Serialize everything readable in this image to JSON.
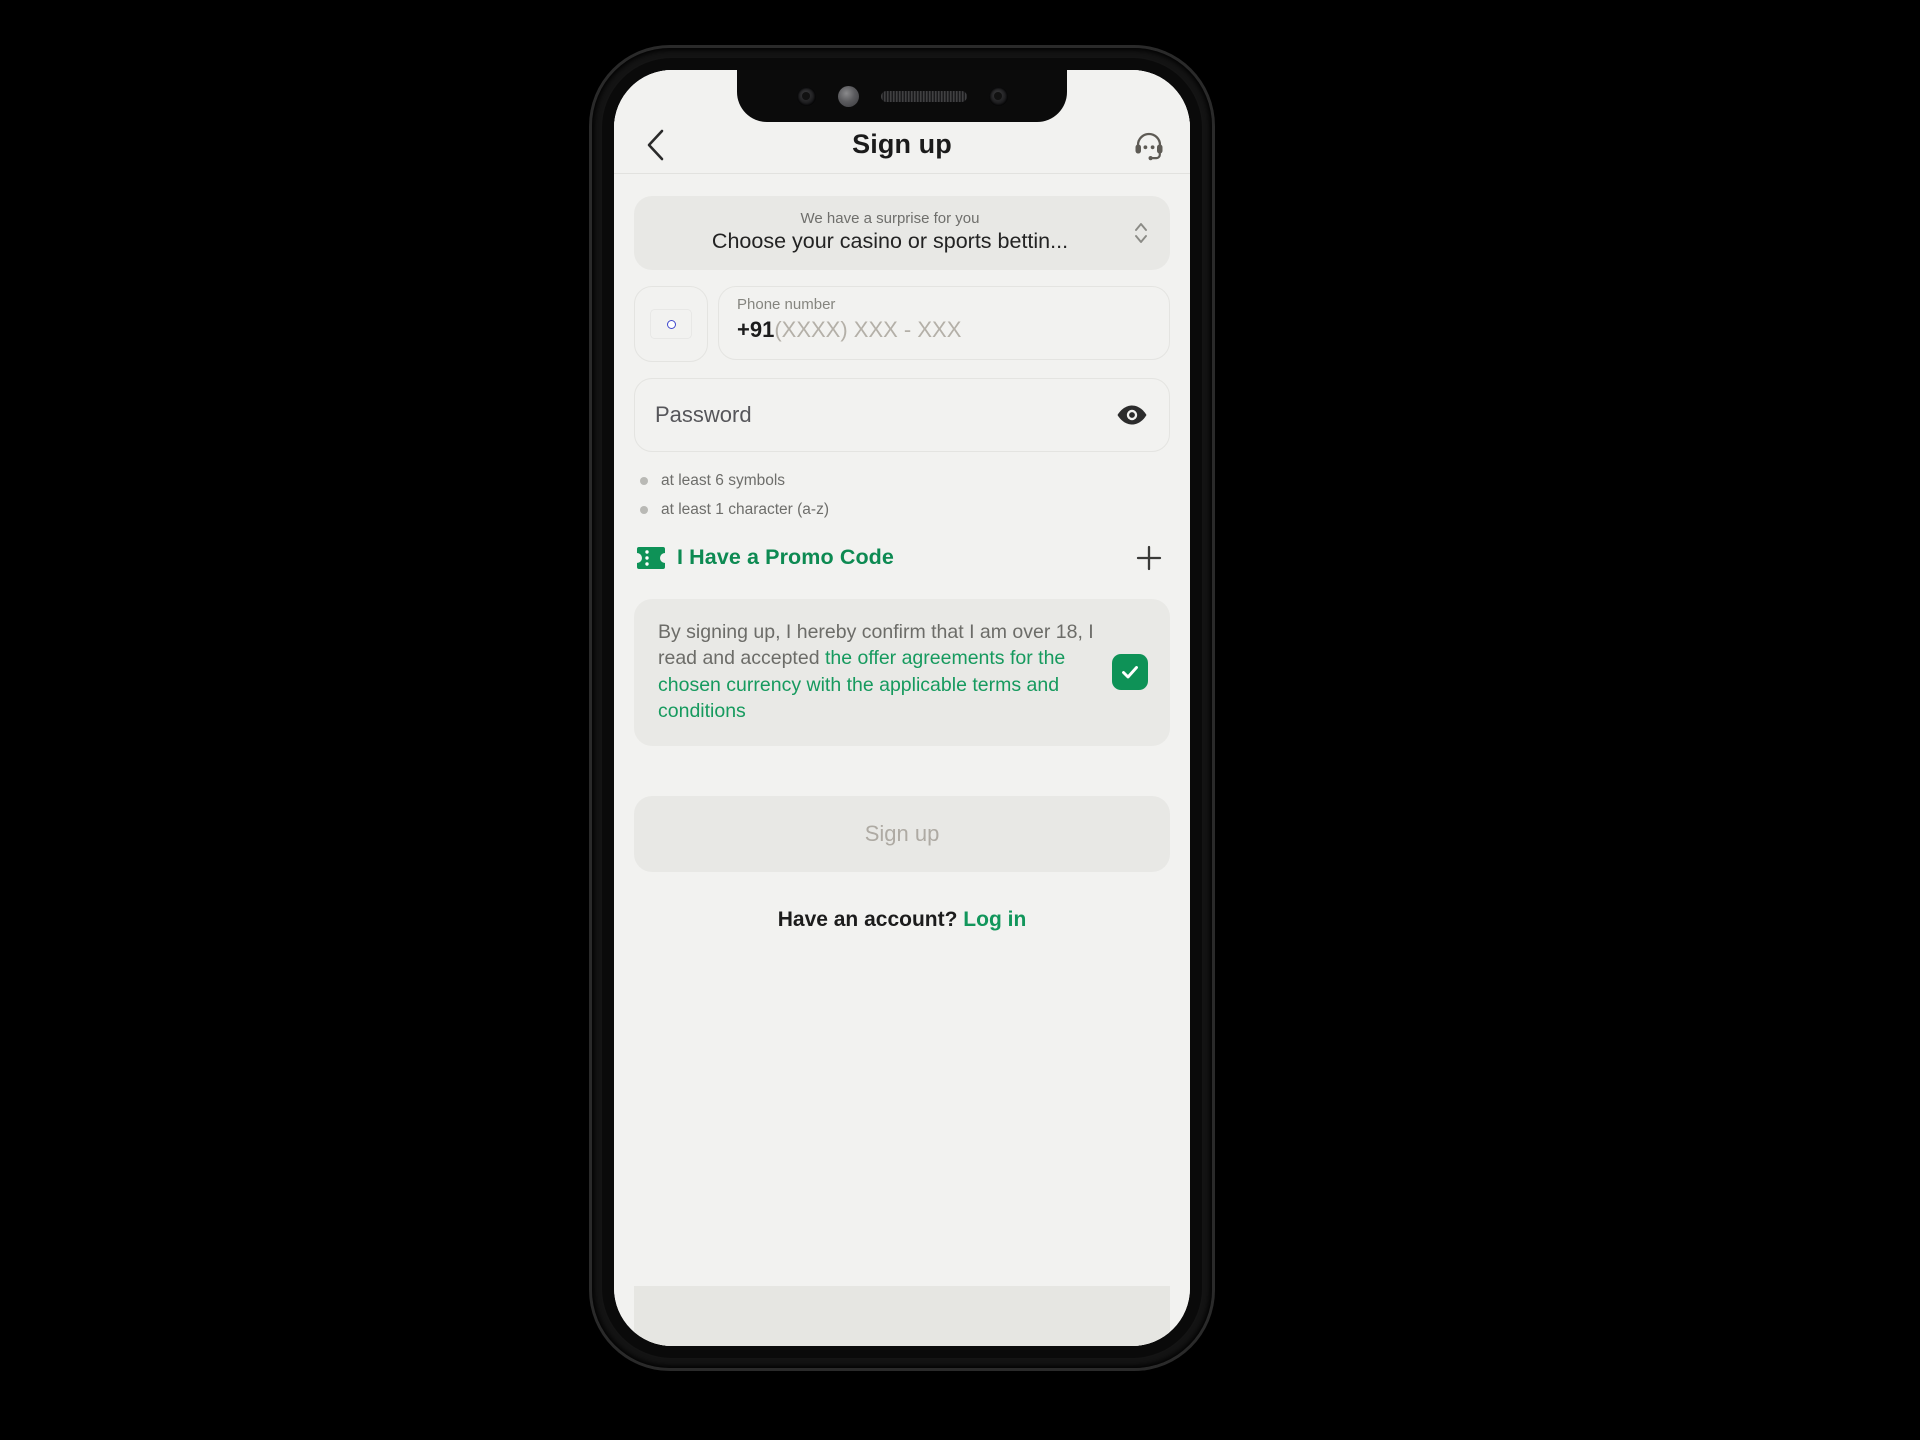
{
  "header": {
    "back_icon": "chevron-left-icon",
    "title": "Sign up",
    "support_icon": "support-headset-icon"
  },
  "bonus_selector": {
    "label": "We have a surprise for you",
    "value": "Choose your casino or sports bettin...",
    "chevron_icon": "chevron-up-down-icon"
  },
  "phone": {
    "country_flag": "flag-india",
    "field_label": "Phone number",
    "country_code": "+91",
    "placeholder": "(XXXX) XXX - XXX"
  },
  "password": {
    "placeholder": "Password",
    "toggle_icon": "eye-icon",
    "hints": [
      "at least 6 symbols",
      "at least 1 character (a-z)"
    ]
  },
  "promo": {
    "icon": "ticket-icon",
    "label": "I Have a Promo Code",
    "add_icon": "plus-icon"
  },
  "terms": {
    "plain_text": "By signing up, I hereby confirm that I am over 18, I read and accepted ",
    "link_text": "the offer agreements for the chosen currency with the applicable terms and conditions",
    "checked": true,
    "check_icon": "checkmark-icon"
  },
  "submit": {
    "label": "Sign up",
    "enabled": false
  },
  "login": {
    "prompt": "Have an account?",
    "link": "Log in"
  },
  "colors": {
    "accent_green": "#0e9257",
    "link_green": "#169a5e",
    "screen_bg": "#f2f2f0",
    "field_bg": "#e8e8e5",
    "muted_text": "#6c6c68"
  }
}
